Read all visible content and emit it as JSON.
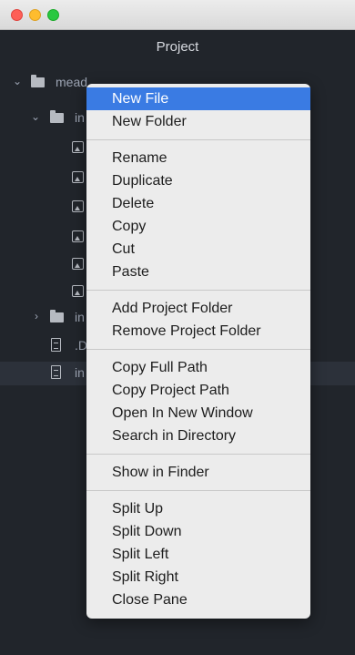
{
  "window": {
    "panel_title": "Project"
  },
  "tree": {
    "root_label": "mead",
    "folder1_label": "in",
    "folder2_label": "in",
    "file1_label": ".D",
    "file2_label": "in"
  },
  "menu": {
    "groups": [
      [
        "New File",
        "New Folder"
      ],
      [
        "Rename",
        "Duplicate",
        "Delete",
        "Copy",
        "Cut",
        "Paste"
      ],
      [
        "Add Project Folder",
        "Remove Project Folder"
      ],
      [
        "Copy Full Path",
        "Copy Project Path",
        "Open In New Window",
        "Search in Directory"
      ],
      [
        "Show in Finder"
      ],
      [
        "Split Up",
        "Split Down",
        "Split Left",
        "Split Right",
        "Close Pane"
      ]
    ],
    "highlighted": "New File"
  },
  "colors": {
    "highlight": "#3a7be3",
    "background": "#21252b",
    "menu_bg": "#ececec"
  }
}
